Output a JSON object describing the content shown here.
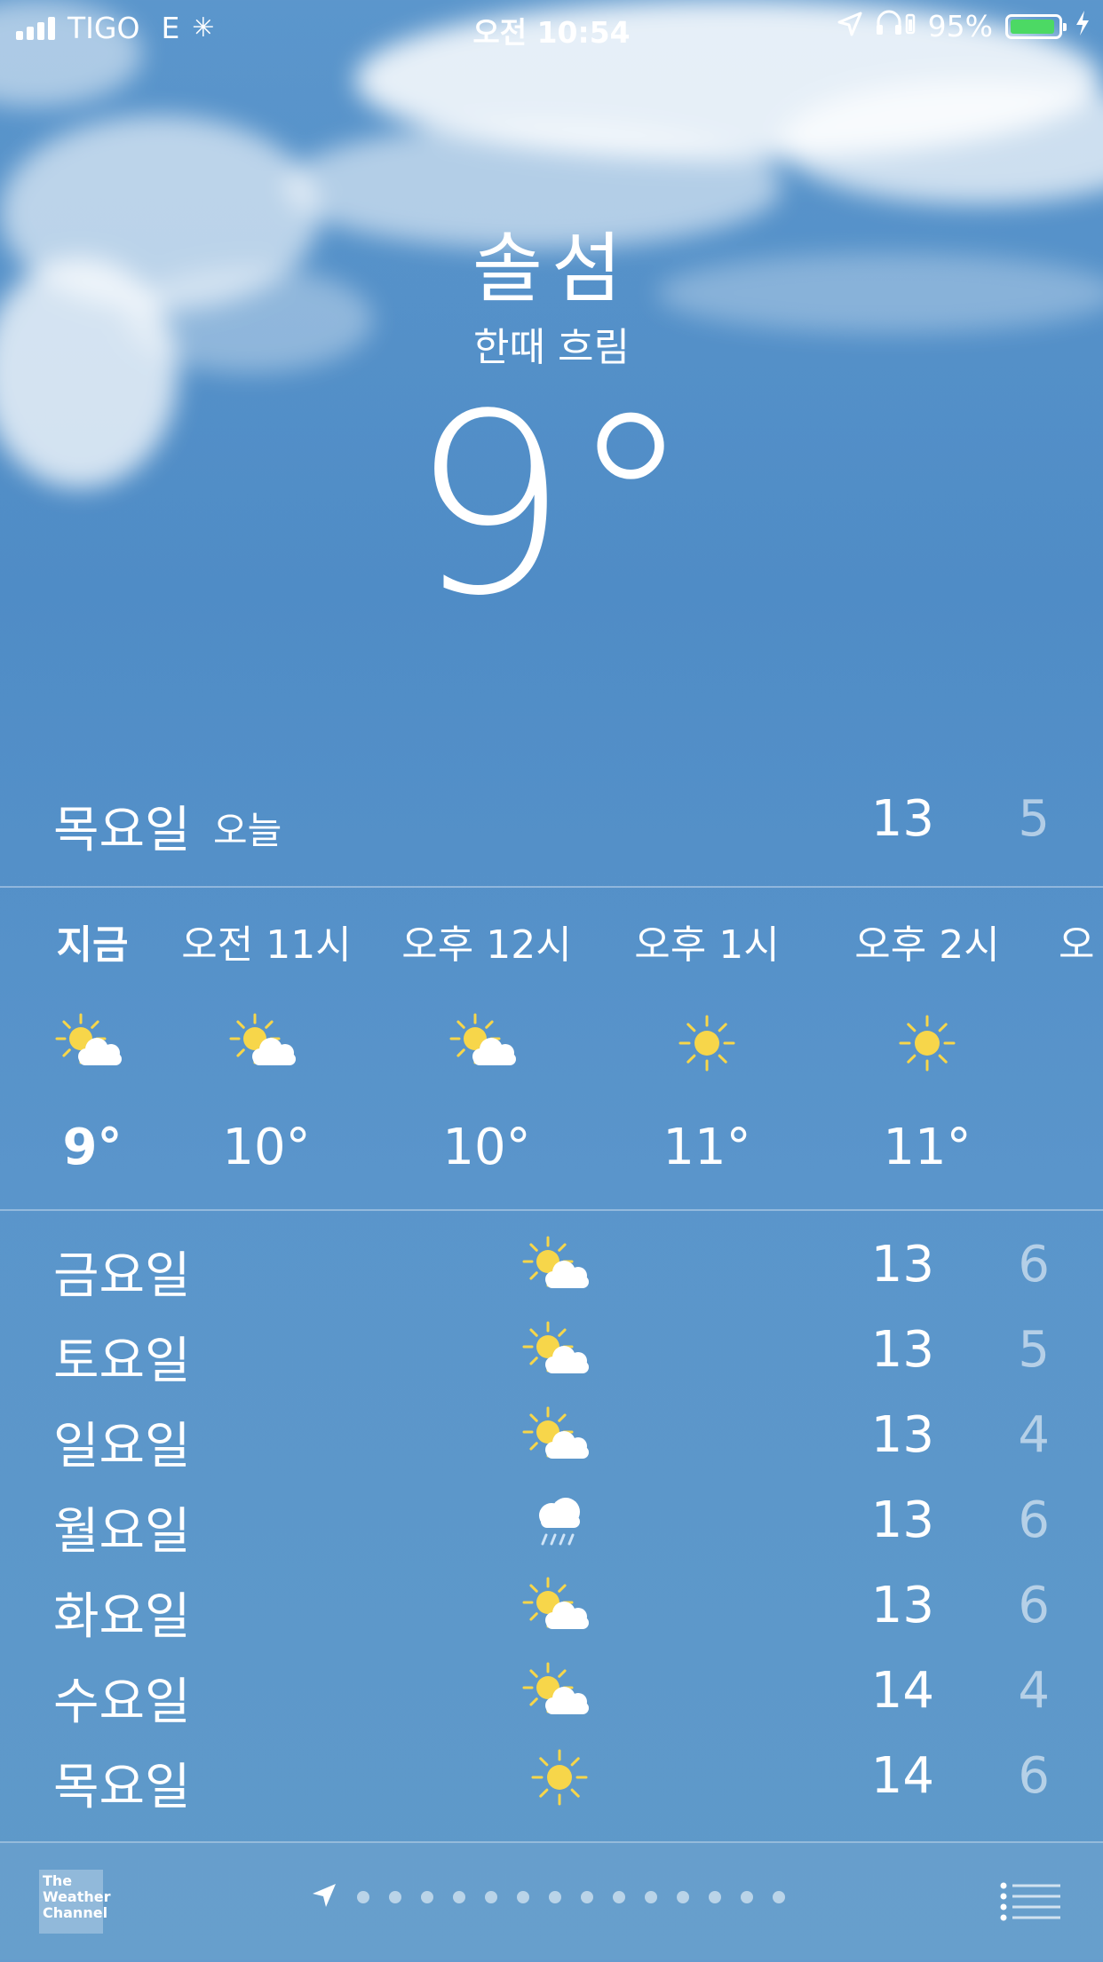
{
  "status_bar": {
    "carrier": "TIGO",
    "network": "E",
    "time": "오전 10:54",
    "battery": "95%",
    "battery_level": 0.95,
    "icons": [
      "signal-icon",
      "activity-spinner-icon",
      "location-arrow-icon",
      "headphones-icon",
      "battery-icon",
      "charging-bolt-icon"
    ]
  },
  "location": {
    "city": "솔섬",
    "condition": "한때 흐림",
    "current_temp": "9°"
  },
  "today": {
    "day": "목요일",
    "tag": "오늘",
    "high": "13",
    "low": "5"
  },
  "hourly": [
    {
      "label": "지금",
      "icon": "partly-cloudy-icon",
      "temp": "9°"
    },
    {
      "label": "오전 11시",
      "icon": "partly-cloudy-icon",
      "temp": "10°"
    },
    {
      "label": "오후 12시",
      "icon": "partly-cloudy-icon",
      "temp": "10°"
    },
    {
      "label": "오후 1시",
      "icon": "sun-icon",
      "temp": "11°"
    },
    {
      "label": "오후 2시",
      "icon": "sun-icon",
      "temp": "11°"
    },
    {
      "label": "오",
      "icon": "",
      "temp": ""
    }
  ],
  "daily": [
    {
      "day": "금요일",
      "icon": "partly-cloudy-icon",
      "high": "13",
      "low": "6"
    },
    {
      "day": "토요일",
      "icon": "partly-cloudy-icon",
      "high": "13",
      "low": "5"
    },
    {
      "day": "일요일",
      "icon": "partly-cloudy-icon",
      "high": "13",
      "low": "4"
    },
    {
      "day": "월요일",
      "icon": "rain-cloud-icon",
      "high": "13",
      "low": "6"
    },
    {
      "day": "화요일",
      "icon": "partly-cloudy-icon",
      "high": "13",
      "low": "6"
    },
    {
      "day": "수요일",
      "icon": "partly-cloudy-icon",
      "high": "14",
      "low": "4"
    },
    {
      "day": "목요일",
      "icon": "sun-icon",
      "high": "14",
      "low": "6"
    }
  ],
  "bottom_bar": {
    "provider_logo": "The Weather Channel",
    "page_dot_count": 14,
    "icons": [
      "location-arrow-icon",
      "list-icon"
    ]
  },
  "colors": {
    "sky": "#5b96cc",
    "sun": "#f7d64a",
    "battery_green": "#4cd964"
  }
}
